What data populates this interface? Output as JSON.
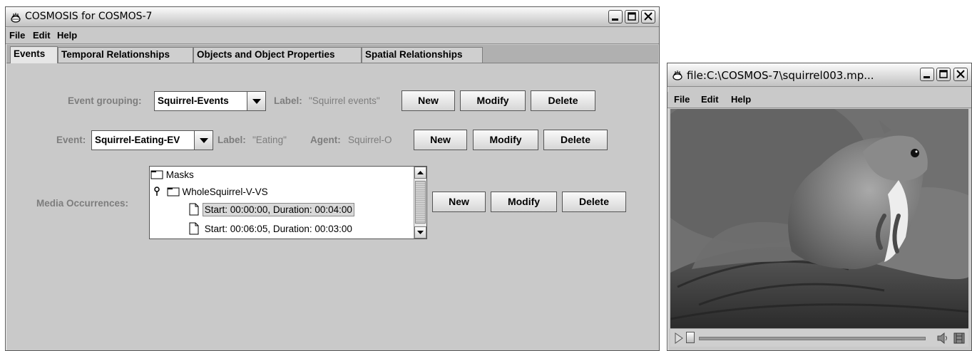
{
  "main_window": {
    "title": "COSMOSIS for COSMOS-7",
    "menu": [
      "File",
      "Edit",
      "Help"
    ],
    "tabs": [
      "Events",
      "Temporal Relationships",
      "Objects and Object Properties",
      "Spatial Relationships"
    ],
    "active_tab": "Events",
    "event_grouping": {
      "label": "Event grouping:",
      "value": "Squirrel-Events",
      "label_key": "Label:",
      "label_value": "\"Squirrel events\"",
      "buttons": [
        "New",
        "Modify",
        "Delete"
      ]
    },
    "event": {
      "label": "Event:",
      "value": "Squirrel-Eating-EV",
      "label_key": "Label:",
      "label_value": "\"Eating\"",
      "agent_key": "Agent:",
      "agent_value": "Squirrel-O",
      "buttons": [
        "New",
        "Modify",
        "Delete"
      ]
    },
    "media_occurrences": {
      "label": "Media Occurrences:",
      "tree": {
        "root": "Masks",
        "node": "WholeSquirrel-V-VS",
        "items": [
          "Start: 00:00:00, Duration: 00:04:00",
          "Start: 00:06:05, Duration: 00:03:00"
        ],
        "selected_index": 0
      },
      "buttons": [
        "New",
        "Modify",
        "Delete"
      ]
    }
  },
  "media_window": {
    "title": "file:C:\\COSMOS-7\\squirrel003.mp...",
    "menu": [
      "File",
      "Edit",
      "Help"
    ],
    "media": "photo of a gray squirrel sitting on a log",
    "playback_position": 0
  }
}
